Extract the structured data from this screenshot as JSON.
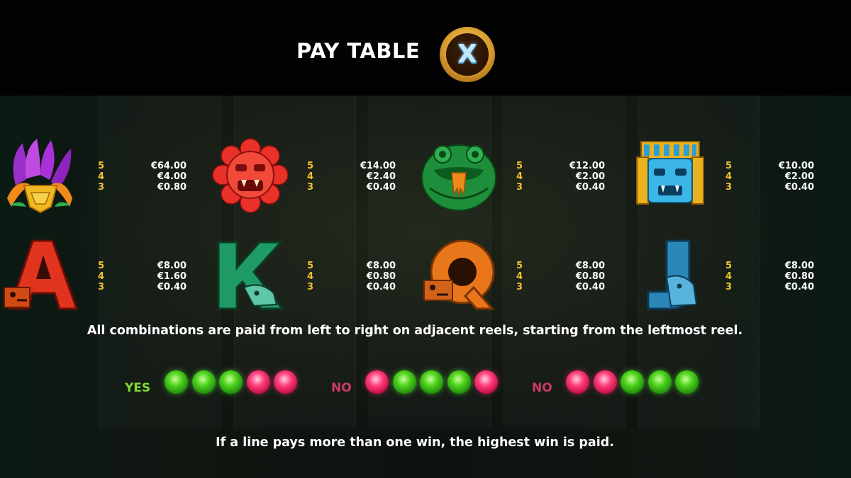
{
  "header": {
    "title": "PAY TABLE",
    "close_label": "X"
  },
  "paytable": [
    {
      "symbol": "feather-headdress-mask",
      "counts": [
        "5",
        "4",
        "3"
      ],
      "pays": [
        "€64.00",
        "€4.00",
        "€0.80"
      ]
    },
    {
      "symbol": "red-sun-mask",
      "counts": [
        "5",
        "4",
        "3"
      ],
      "pays": [
        "€14.00",
        "€2.40",
        "€0.40"
      ]
    },
    {
      "symbol": "green-serpent-mask",
      "counts": [
        "5",
        "4",
        "3"
      ],
      "pays": [
        "€12.00",
        "€2.00",
        "€0.40"
      ]
    },
    {
      "symbol": "blue-jade-mask",
      "counts": [
        "5",
        "4",
        "3"
      ],
      "pays": [
        "€10.00",
        "€2.00",
        "€0.40"
      ]
    },
    {
      "symbol": "letter-a",
      "counts": [
        "5",
        "4",
        "3"
      ],
      "pays": [
        "€8.00",
        "€1.60",
        "€0.40"
      ]
    },
    {
      "symbol": "letter-k",
      "counts": [
        "5",
        "4",
        "3"
      ],
      "pays": [
        "€8.00",
        "€0.80",
        "€0.40"
      ]
    },
    {
      "symbol": "letter-q",
      "counts": [
        "5",
        "4",
        "3"
      ],
      "pays": [
        "€8.00",
        "€0.80",
        "€0.40"
      ]
    },
    {
      "symbol": "letter-j",
      "counts": [
        "5",
        "4",
        "3"
      ],
      "pays": [
        "€8.00",
        "€0.80",
        "€0.40"
      ]
    }
  ],
  "rules": {
    "combinations_text": "All combinations are paid from left to right on adjacent reels, starting from the leftmost reel.",
    "highest_win_text": "If a line pays more than one win, the highest win is paid."
  },
  "examples": [
    {
      "label": "YES",
      "label_color": "#7fdc2c",
      "gems": [
        "green",
        "green",
        "green",
        "red",
        "red"
      ]
    },
    {
      "label": "NO",
      "label_color": "#c93b64",
      "gems": [
        "red",
        "green",
        "green",
        "green",
        "red"
      ]
    },
    {
      "label": "NO",
      "label_color": "#c93b64",
      "gems": [
        "red",
        "red",
        "green",
        "green",
        "green"
      ]
    }
  ]
}
